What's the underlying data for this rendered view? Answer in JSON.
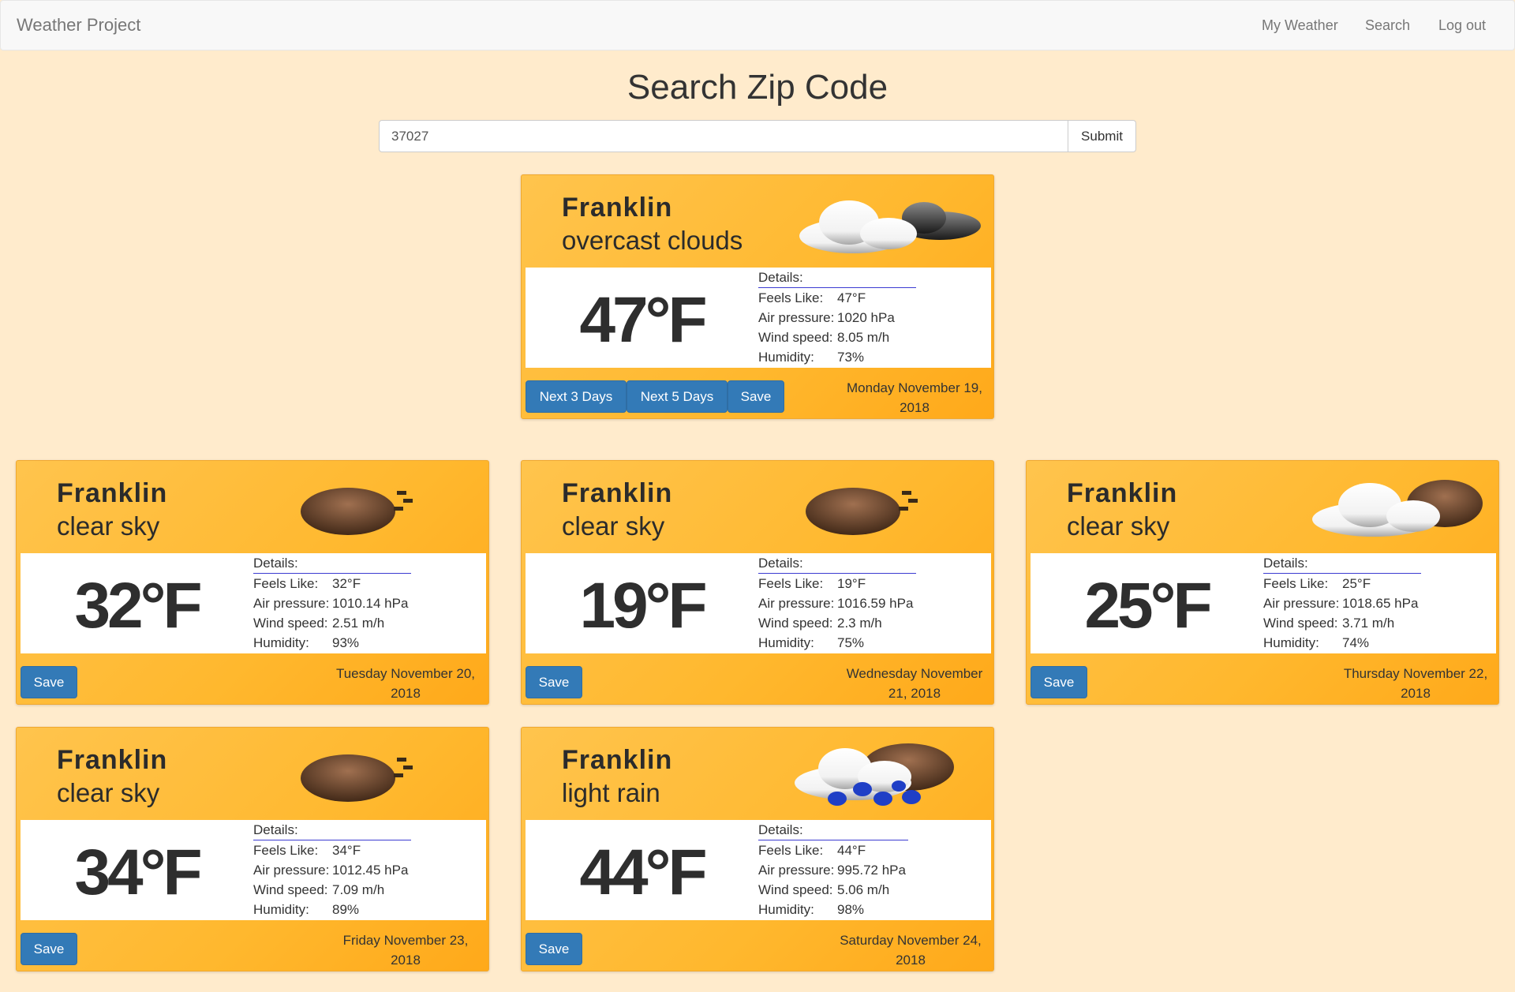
{
  "nav": {
    "brand": "Weather Project",
    "links": [
      "My Weather",
      "Search",
      "Log out"
    ]
  },
  "search": {
    "title": "Search Zip Code",
    "value": "37027",
    "submit_label": "Submit"
  },
  "current": {
    "city": "Franklin",
    "description": "overcast clouds",
    "icon": "overcast-clouds-icon",
    "temp": "47°F",
    "details_label": "Details:",
    "rows": [
      {
        "label": "Feels Like:",
        "value": "47°F"
      },
      {
        "label": "Air pressure:",
        "value": "1020 hPa"
      },
      {
        "label": "Wind speed:",
        "value": "8.05 m/h"
      },
      {
        "label": "Humidity:",
        "value": "73%"
      }
    ],
    "buttons": [
      "Next 3 Days",
      "Next 5 Days",
      "Save"
    ],
    "date": "Monday November 19, 2018"
  },
  "forecast": [
    {
      "city": "Franklin",
      "description": "clear sky",
      "icon": "clear-sky-night-icon",
      "temp": "32°F",
      "details_label": "Details:",
      "rows": [
        {
          "label": "Feels Like:",
          "value": "32°F"
        },
        {
          "label": "Air pressure:",
          "value": "1010.14 hPa"
        },
        {
          "label": "Wind speed:",
          "value": "2.51 m/h"
        },
        {
          "label": "Humidity:",
          "value": "93%"
        }
      ],
      "save_label": "Save",
      "date": "Tuesday November 20, 2018"
    },
    {
      "city": "Franklin",
      "description": "clear sky",
      "icon": "clear-sky-night-icon",
      "temp": "19°F",
      "details_label": "Details:",
      "rows": [
        {
          "label": "Feels Like:",
          "value": "19°F"
        },
        {
          "label": "Air pressure:",
          "value": "1016.59 hPa"
        },
        {
          "label": "Wind speed:",
          "value": "2.3 m/h"
        },
        {
          "label": "Humidity:",
          "value": "75%"
        }
      ],
      "save_label": "Save",
      "date": "Wednesday November 21, 2018"
    },
    {
      "city": "Franklin",
      "description": "clear sky",
      "icon": "few-clouds-night-icon",
      "temp": "25°F",
      "details_label": "Details:",
      "rows": [
        {
          "label": "Feels Like:",
          "value": "25°F"
        },
        {
          "label": "Air pressure:",
          "value": "1018.65 hPa"
        },
        {
          "label": "Wind speed:",
          "value": "3.71 m/h"
        },
        {
          "label": "Humidity:",
          "value": "74%"
        }
      ],
      "save_label": "Save",
      "date": "Thursday November 22, 2018"
    },
    {
      "city": "Franklin",
      "description": "clear sky",
      "icon": "clear-sky-night-icon",
      "temp": "34°F",
      "details_label": "Details:",
      "rows": [
        {
          "label": "Feels Like:",
          "value": "34°F"
        },
        {
          "label": "Air pressure:",
          "value": "1012.45 hPa"
        },
        {
          "label": "Wind speed:",
          "value": "7.09 m/h"
        },
        {
          "label": "Humidity:",
          "value": "89%"
        }
      ],
      "save_label": "Save",
      "date": "Friday November 23, 2018"
    },
    {
      "city": "Franklin",
      "description": "light rain",
      "icon": "light-rain-night-icon",
      "temp": "44°F",
      "details_label": "Details:",
      "rows": [
        {
          "label": "Feels Like:",
          "value": "44°F"
        },
        {
          "label": "Air pressure:",
          "value": "995.72 hPa"
        },
        {
          "label": "Wind speed:",
          "value": "5.06 m/h"
        },
        {
          "label": "Humidity:",
          "value": "98%"
        }
      ],
      "save_label": "Save",
      "date": "Saturday November 24, 2018"
    }
  ]
}
